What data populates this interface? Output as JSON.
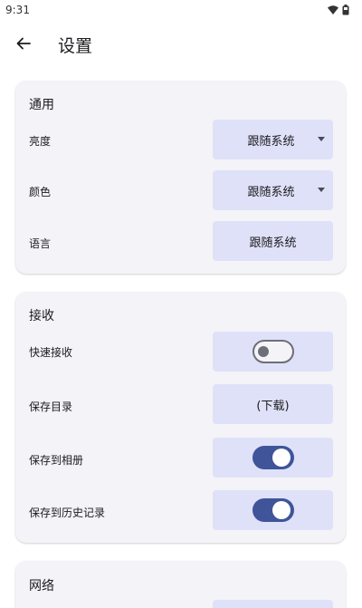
{
  "status_bar": {
    "time": "9:31",
    "icons": [
      "wifi-icon",
      "battery-icon"
    ]
  },
  "app_bar": {
    "back_icon": "arrow-left-icon",
    "title": "设置"
  },
  "sections": {
    "general": {
      "title": "通用",
      "brightness": {
        "label": "亮度",
        "value": "跟随系统",
        "has_dropdown": true
      },
      "color": {
        "label": "颜色",
        "value": "跟随系统",
        "has_dropdown": true
      },
      "language": {
        "label": "语言",
        "value": "跟随系统"
      }
    },
    "receive": {
      "title": "接收",
      "quick_receive": {
        "label": "快速接收",
        "enabled": false
      },
      "save_dir": {
        "label": "保存目录",
        "value": "(下载)"
      },
      "save_to_album": {
        "label": "保存到相册",
        "enabled": true
      },
      "save_to_history": {
        "label": "保存到历史记录",
        "enabled": true
      }
    },
    "network": {
      "title": "网络"
    }
  },
  "colors": {
    "card_bg": "#f3f3f8",
    "control_bg": "#dfe1f8",
    "toggle_on": "#3f5499",
    "toggle_off_border": "#6e6e78"
  }
}
